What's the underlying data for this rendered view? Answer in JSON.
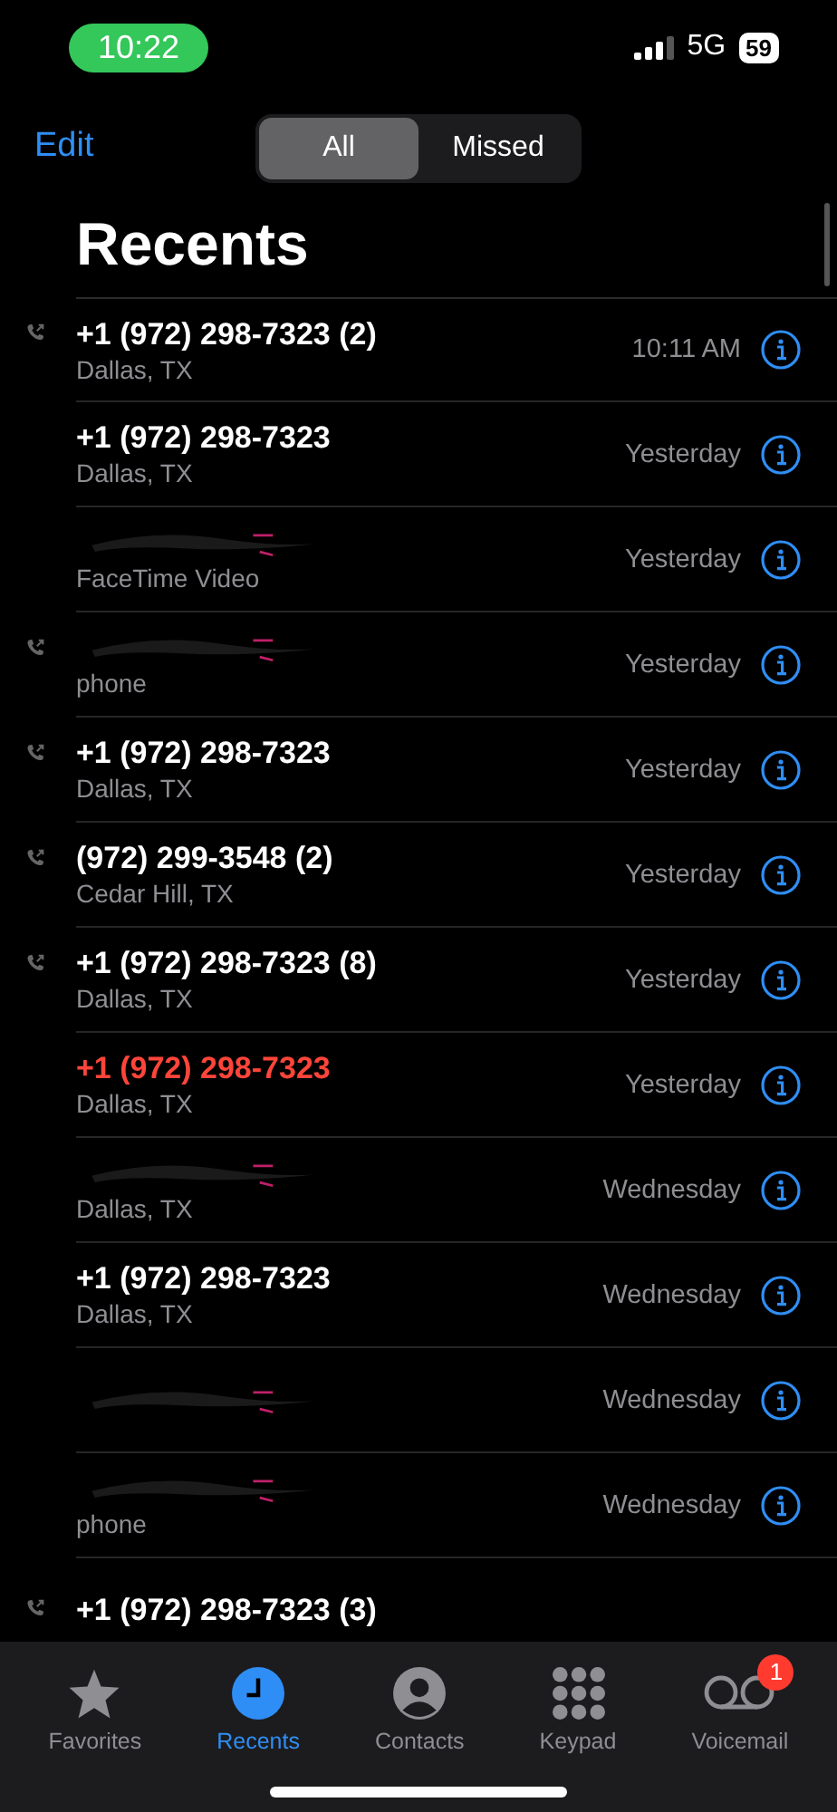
{
  "status_bar": {
    "time": "10:22",
    "network": "5G",
    "battery": "59"
  },
  "nav": {
    "edit": "Edit",
    "segments": [
      {
        "label": "All",
        "selected": true
      },
      {
        "label": "Missed",
        "selected": false
      }
    ]
  },
  "title": "Recents",
  "calls": [
    {
      "name": "+1 (972) 298-7323 (2)",
      "subtitle": "Dallas, TX",
      "when": "10:11 AM",
      "outgoing": true,
      "missed": false,
      "redacted": false
    },
    {
      "name": "+1 (972) 298-7323",
      "subtitle": "Dallas, TX",
      "when": "Yesterday",
      "outgoing": false,
      "missed": false,
      "redacted": false
    },
    {
      "subtitle": "FaceTime Video",
      "when": "Yesterday",
      "outgoing": false,
      "missed": false,
      "redacted": true
    },
    {
      "subtitle": "phone",
      "when": "Yesterday",
      "outgoing": true,
      "missed": false,
      "redacted": true
    },
    {
      "name": "+1 (972) 298-7323",
      "subtitle": "Dallas, TX",
      "when": "Yesterday",
      "outgoing": true,
      "missed": false,
      "redacted": false
    },
    {
      "name": "(972) 299-3548 (2)",
      "subtitle": "Cedar Hill, TX",
      "when": "Yesterday",
      "outgoing": true,
      "missed": false,
      "redacted": false
    },
    {
      "name": "+1 (972) 298-7323 (8)",
      "subtitle": "Dallas, TX",
      "when": "Yesterday",
      "outgoing": true,
      "missed": false,
      "redacted": false
    },
    {
      "name": "+1 (972) 298-7323",
      "subtitle": "Dallas, TX",
      "when": "Yesterday",
      "outgoing": false,
      "missed": true,
      "redacted": false
    },
    {
      "subtitle": "Dallas, TX",
      "when": "Wednesday",
      "outgoing": false,
      "missed": false,
      "redacted": true
    },
    {
      "name": "+1 (972) 298-7323",
      "subtitle": "Dallas, TX",
      "when": "Wednesday",
      "outgoing": false,
      "missed": false,
      "redacted": false
    },
    {
      "when": "Wednesday",
      "outgoing": false,
      "missed": false,
      "redacted": true
    },
    {
      "subtitle": "phone",
      "when": "Wednesday",
      "outgoing": false,
      "missed": false,
      "redacted": true
    },
    {
      "name": "+1 (972) 298-7323 (3)",
      "outgoing": true,
      "missed": false,
      "redacted": false
    }
  ],
  "tabs": [
    {
      "kind": "star",
      "label": "Favorites",
      "selected": false
    },
    {
      "kind": "clock",
      "label": "Recents",
      "selected": true
    },
    {
      "kind": "person",
      "label": "Contacts",
      "selected": false
    },
    {
      "kind": "keypad",
      "label": "Keypad",
      "selected": false
    },
    {
      "kind": "voicemail",
      "label": "Voicemail",
      "selected": false,
      "badge": "1"
    }
  ]
}
